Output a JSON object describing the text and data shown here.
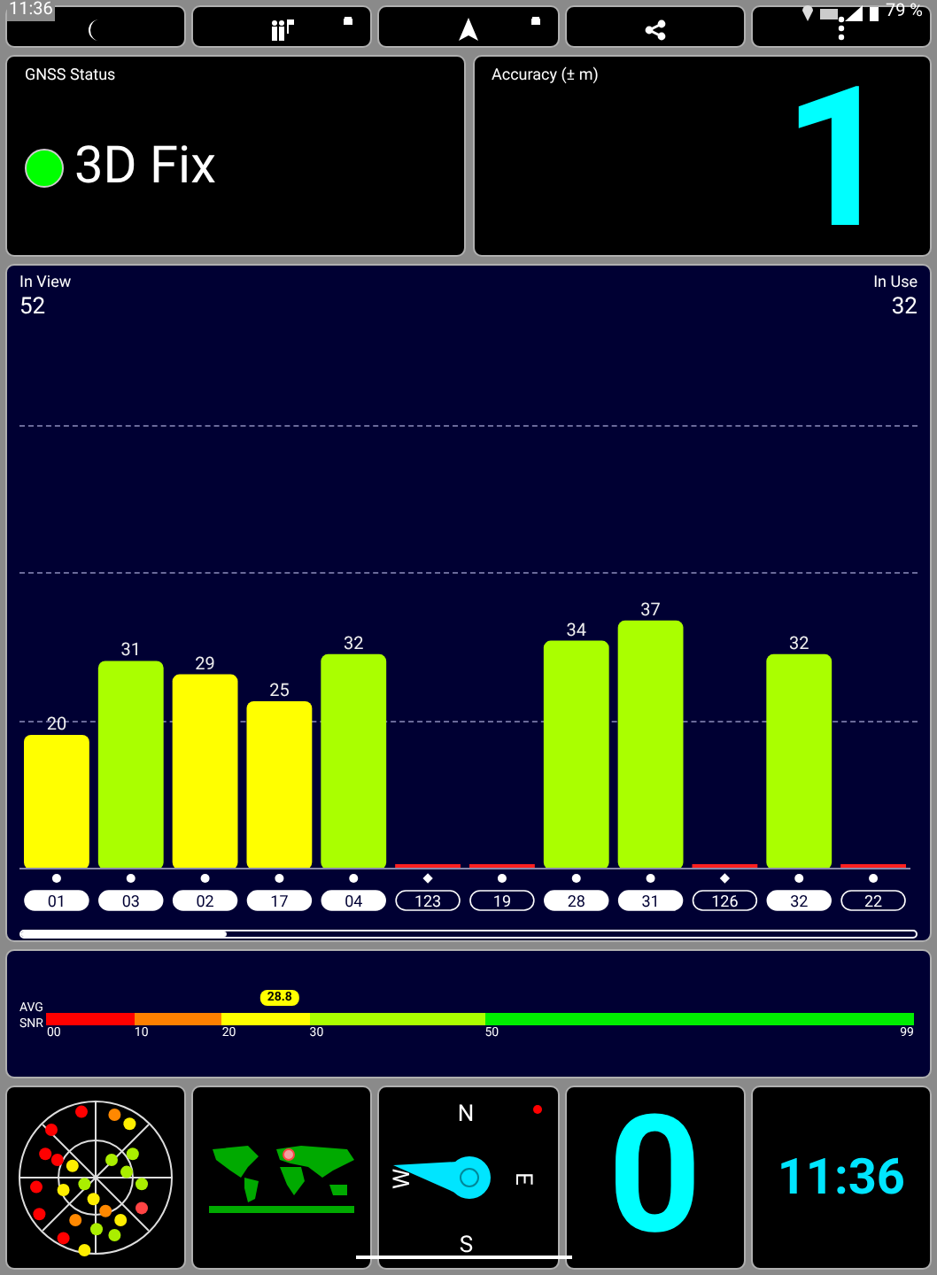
{
  "status_bar": {
    "time": "11:36",
    "battery": "79 %"
  },
  "toolbar": [
    {
      "locked": false
    },
    {
      "locked": true
    },
    {
      "locked": true
    },
    {
      "locked": false
    },
    {
      "locked": false
    }
  ],
  "gnss_status": {
    "title": "GNSS Status",
    "fix": "3D Fix",
    "color": "#00ff00"
  },
  "accuracy": {
    "title": "Accuracy (± m)",
    "value": "1"
  },
  "satellites_panel": {
    "in_view_label": "In View",
    "in_view": "52",
    "in_use_label": "In Use",
    "in_use": "32",
    "chart_data": {
      "type": "bar",
      "categories": [
        "01",
        "03",
        "02",
        "17",
        "04",
        "123",
        "19",
        "28",
        "31",
        "126",
        "32",
        "22"
      ],
      "values": [
        20,
        31,
        29,
        25,
        32,
        null,
        null,
        34,
        37,
        null,
        32,
        null
      ],
      "data_labels": true
    },
    "satellites": [
      {
        "used": true,
        "kind": "dot"
      },
      {
        "used": true,
        "kind": "dot"
      },
      {
        "used": true,
        "kind": "dot"
      },
      {
        "used": true,
        "kind": "dot"
      },
      {
        "used": true,
        "kind": "dot"
      },
      {
        "used": false,
        "kind": "diamond"
      },
      {
        "used": false,
        "kind": "dot"
      },
      {
        "used": true,
        "kind": "dot"
      },
      {
        "used": true,
        "kind": "dot"
      },
      {
        "used": false,
        "kind": "diamond"
      },
      {
        "used": true,
        "kind": "dot"
      },
      {
        "used": false,
        "kind": "dot"
      }
    ]
  },
  "snr": {
    "label": "AVG",
    "label_2": "SNR",
    "value": "28.8",
    "level": 0.291,
    "ticks": [
      "00",
      "10",
      "20",
      "30",
      "50",
      "99"
    ]
  },
  "compass": {
    "north": "N",
    "east": "E",
    "south": "S",
    "west": "W"
  },
  "speed": {
    "value": "0"
  },
  "clock": {
    "time": "11:36"
  }
}
